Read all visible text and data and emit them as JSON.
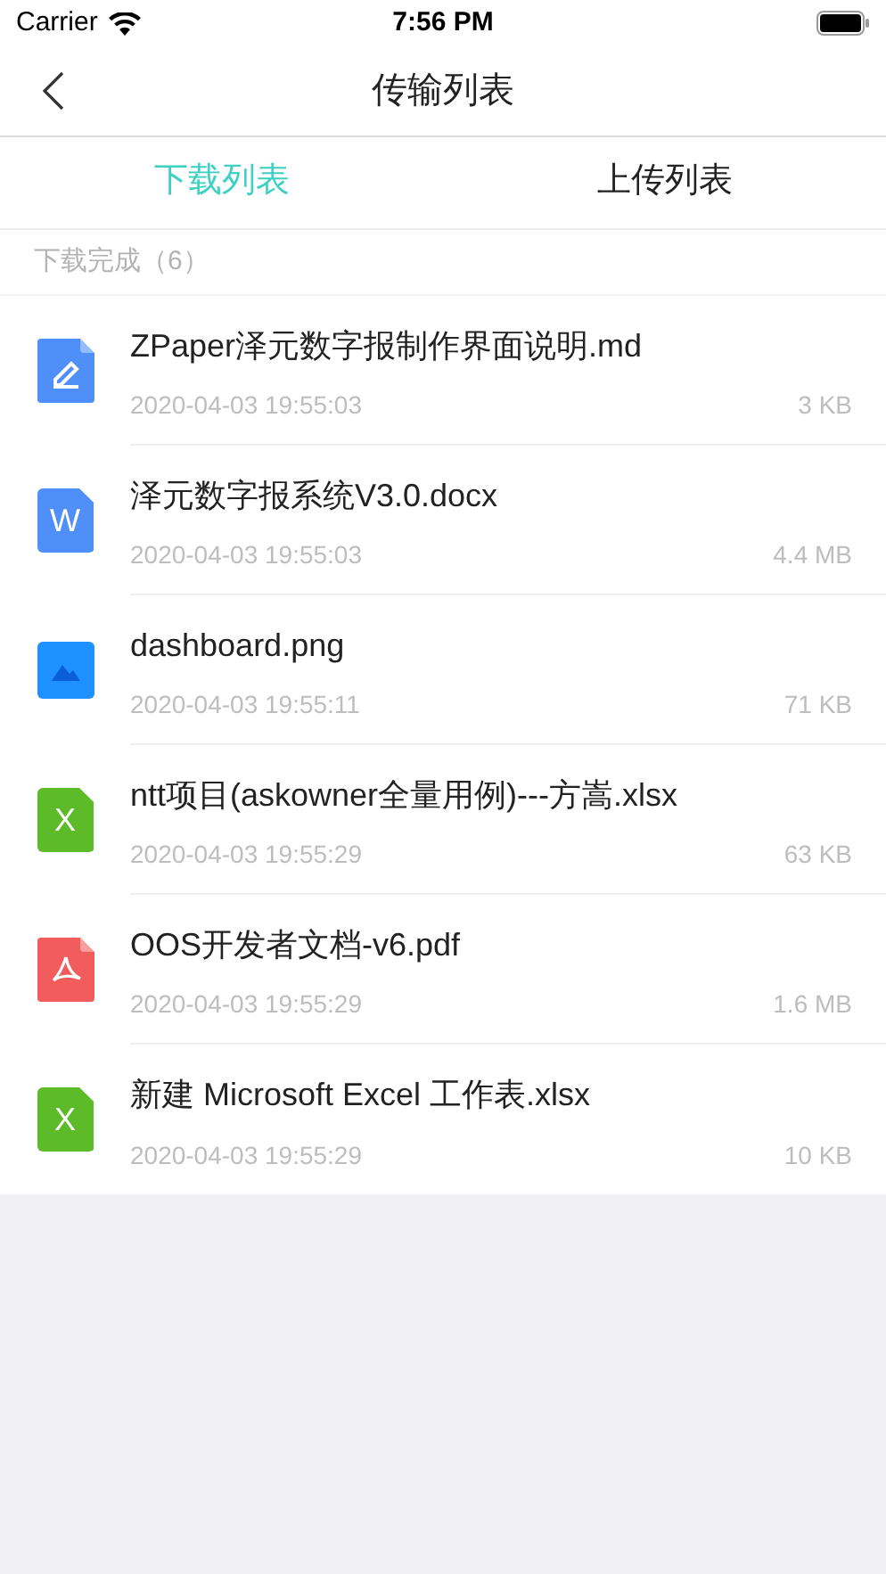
{
  "status_bar": {
    "carrier": "Carrier",
    "time": "7:56 PM"
  },
  "nav": {
    "title": "传输列表"
  },
  "tabs": [
    {
      "label": "下载列表",
      "selected": true
    },
    {
      "label": "上传列表",
      "selected": false
    }
  ],
  "section": {
    "title": "下载完成（6）"
  },
  "files": [
    {
      "kind": "note",
      "name": "ZPaper泽元数字报制作界面说明.md",
      "date": "2020-04-03 19:55:03",
      "size": "3 KB"
    },
    {
      "kind": "word",
      "letter": "W",
      "name": "泽元数字报系统V3.0.docx",
      "date": "2020-04-03 19:55:03",
      "size": "4.4 MB"
    },
    {
      "kind": "image",
      "name": "dashboard.png",
      "date": "2020-04-03 19:55:11",
      "size": "71 KB"
    },
    {
      "kind": "excel",
      "letter": "X",
      "name": "ntt项目(askowner全量用例)---方嵩.xlsx",
      "date": "2020-04-03 19:55:29",
      "size": "63 KB"
    },
    {
      "kind": "pdf",
      "name": "OOS开发者文档-v6.pdf",
      "date": "2020-04-03 19:55:29",
      "size": "1.6 MB"
    },
    {
      "kind": "excel",
      "letter": "X",
      "name": "新建 Microsoft Excel 工作表.xlsx",
      "date": "2020-04-03 19:55:29",
      "size": "10 KB"
    }
  ]
}
